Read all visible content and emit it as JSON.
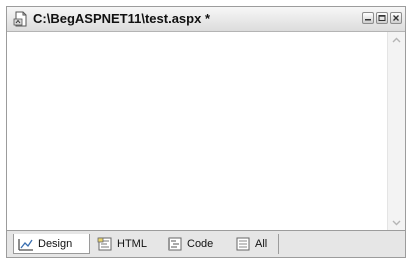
{
  "window": {
    "title": "C:\\BegASPNET11\\test.aspx *",
    "icon": "aspx-document-icon",
    "controls": [
      "minimize-icon",
      "restore-icon",
      "close-icon"
    ]
  },
  "tabs": [
    {
      "label": "Design",
      "icon": "design-view-icon",
      "active": true
    },
    {
      "label": "HTML",
      "icon": "html-view-icon",
      "active": false
    },
    {
      "label": "Code",
      "icon": "code-view-icon",
      "active": false
    },
    {
      "label": "All",
      "icon": "all-view-icon",
      "active": false
    }
  ],
  "colors": {
    "titlebar": "#e6e6e6",
    "tabbar": "#e6e6e6",
    "editor": "#ffffff"
  }
}
